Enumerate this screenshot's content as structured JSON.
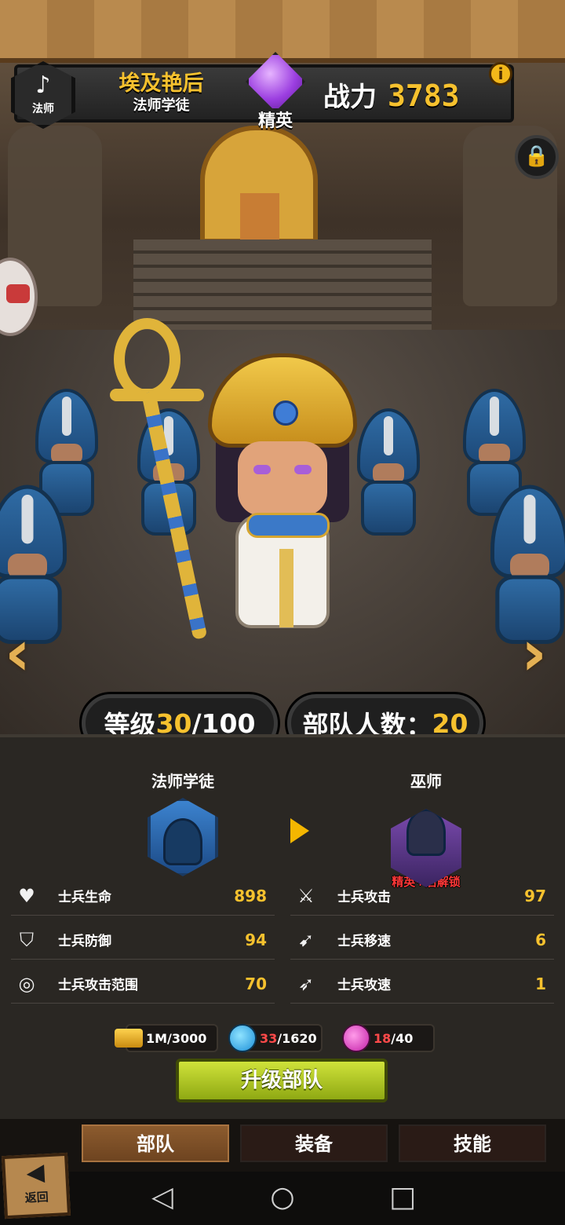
{
  "header": {
    "class_label": "法师",
    "hero_name": "埃及艳后",
    "unit_name": "法师学徒",
    "rank": "精英",
    "power_label": "战力",
    "power_value": "3783",
    "info_icon": "i"
  },
  "level": {
    "label": "等级",
    "current": "30",
    "max": "/100"
  },
  "troops": {
    "label": "部队人数：",
    "count": "20"
  },
  "upgrade_path": {
    "current_unit": "法师学徒",
    "next_unit": "巫师",
    "next_unit_note": "精英+后解锁"
  },
  "stats": [
    {
      "icon": "heart-icon",
      "label": "士兵生命",
      "value": "898"
    },
    {
      "icon": "swords-icon",
      "label": "士兵攻击",
      "value": "97"
    },
    {
      "icon": "shield-icon",
      "label": "士兵防御",
      "value": "94"
    },
    {
      "icon": "running-icon",
      "label": "士兵移速",
      "value": "6"
    },
    {
      "icon": "target-icon",
      "label": "士兵攻击范围",
      "value": "70"
    },
    {
      "icon": "attack-speed-icon",
      "label": "士兵攻速",
      "value": "1"
    }
  ],
  "resources": {
    "gold": "1M/3000",
    "blue_have": "33",
    "blue_need": "/1620",
    "pink_have": "18",
    "pink_need": "/40"
  },
  "upgrade_button": "升级部队",
  "tabs": [
    "部队",
    "装备",
    "技能"
  ],
  "back_label": "返回",
  "colors": {
    "accent_gold": "#f6c12e",
    "upgrade_green": "#b3c926",
    "alert_red": "#ff4a4a"
  }
}
